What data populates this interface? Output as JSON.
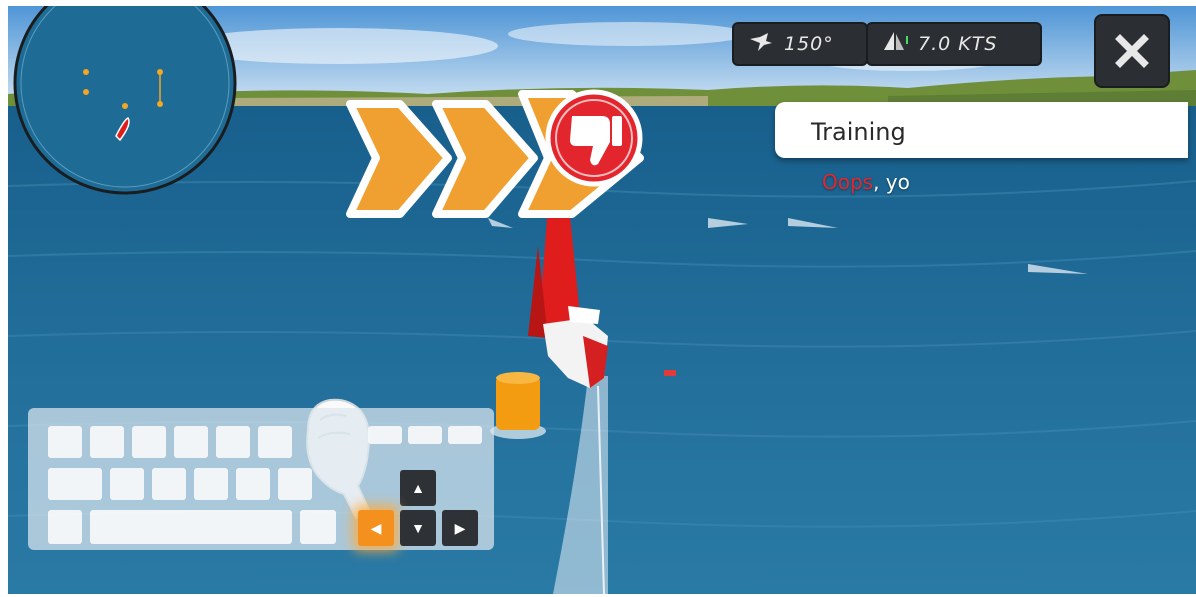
{
  "hud": {
    "wind_angle": "150°",
    "boat_speed": "7.0 KTS",
    "wind_icon": "wind-vane-icon",
    "sail_icon": "sail-icon",
    "close_icon": "close-icon"
  },
  "training": {
    "title": "Training",
    "message_highlight": "Oops",
    "message_rest": ", yo"
  },
  "feedback": {
    "icon": "thumbs-down-icon",
    "arrow_icon": "chevron-right-icon"
  },
  "keyboard": {
    "highlighted_key": "left-arrow",
    "arrows": [
      "▲",
      "◀",
      "▼",
      "▶"
    ]
  },
  "colors": {
    "water": "#1f6690",
    "arrow_orange": "#f0a030",
    "hud_dark": "#2b2f33",
    "alert_red": "#e3262e",
    "key_orange": "#f4911e"
  }
}
